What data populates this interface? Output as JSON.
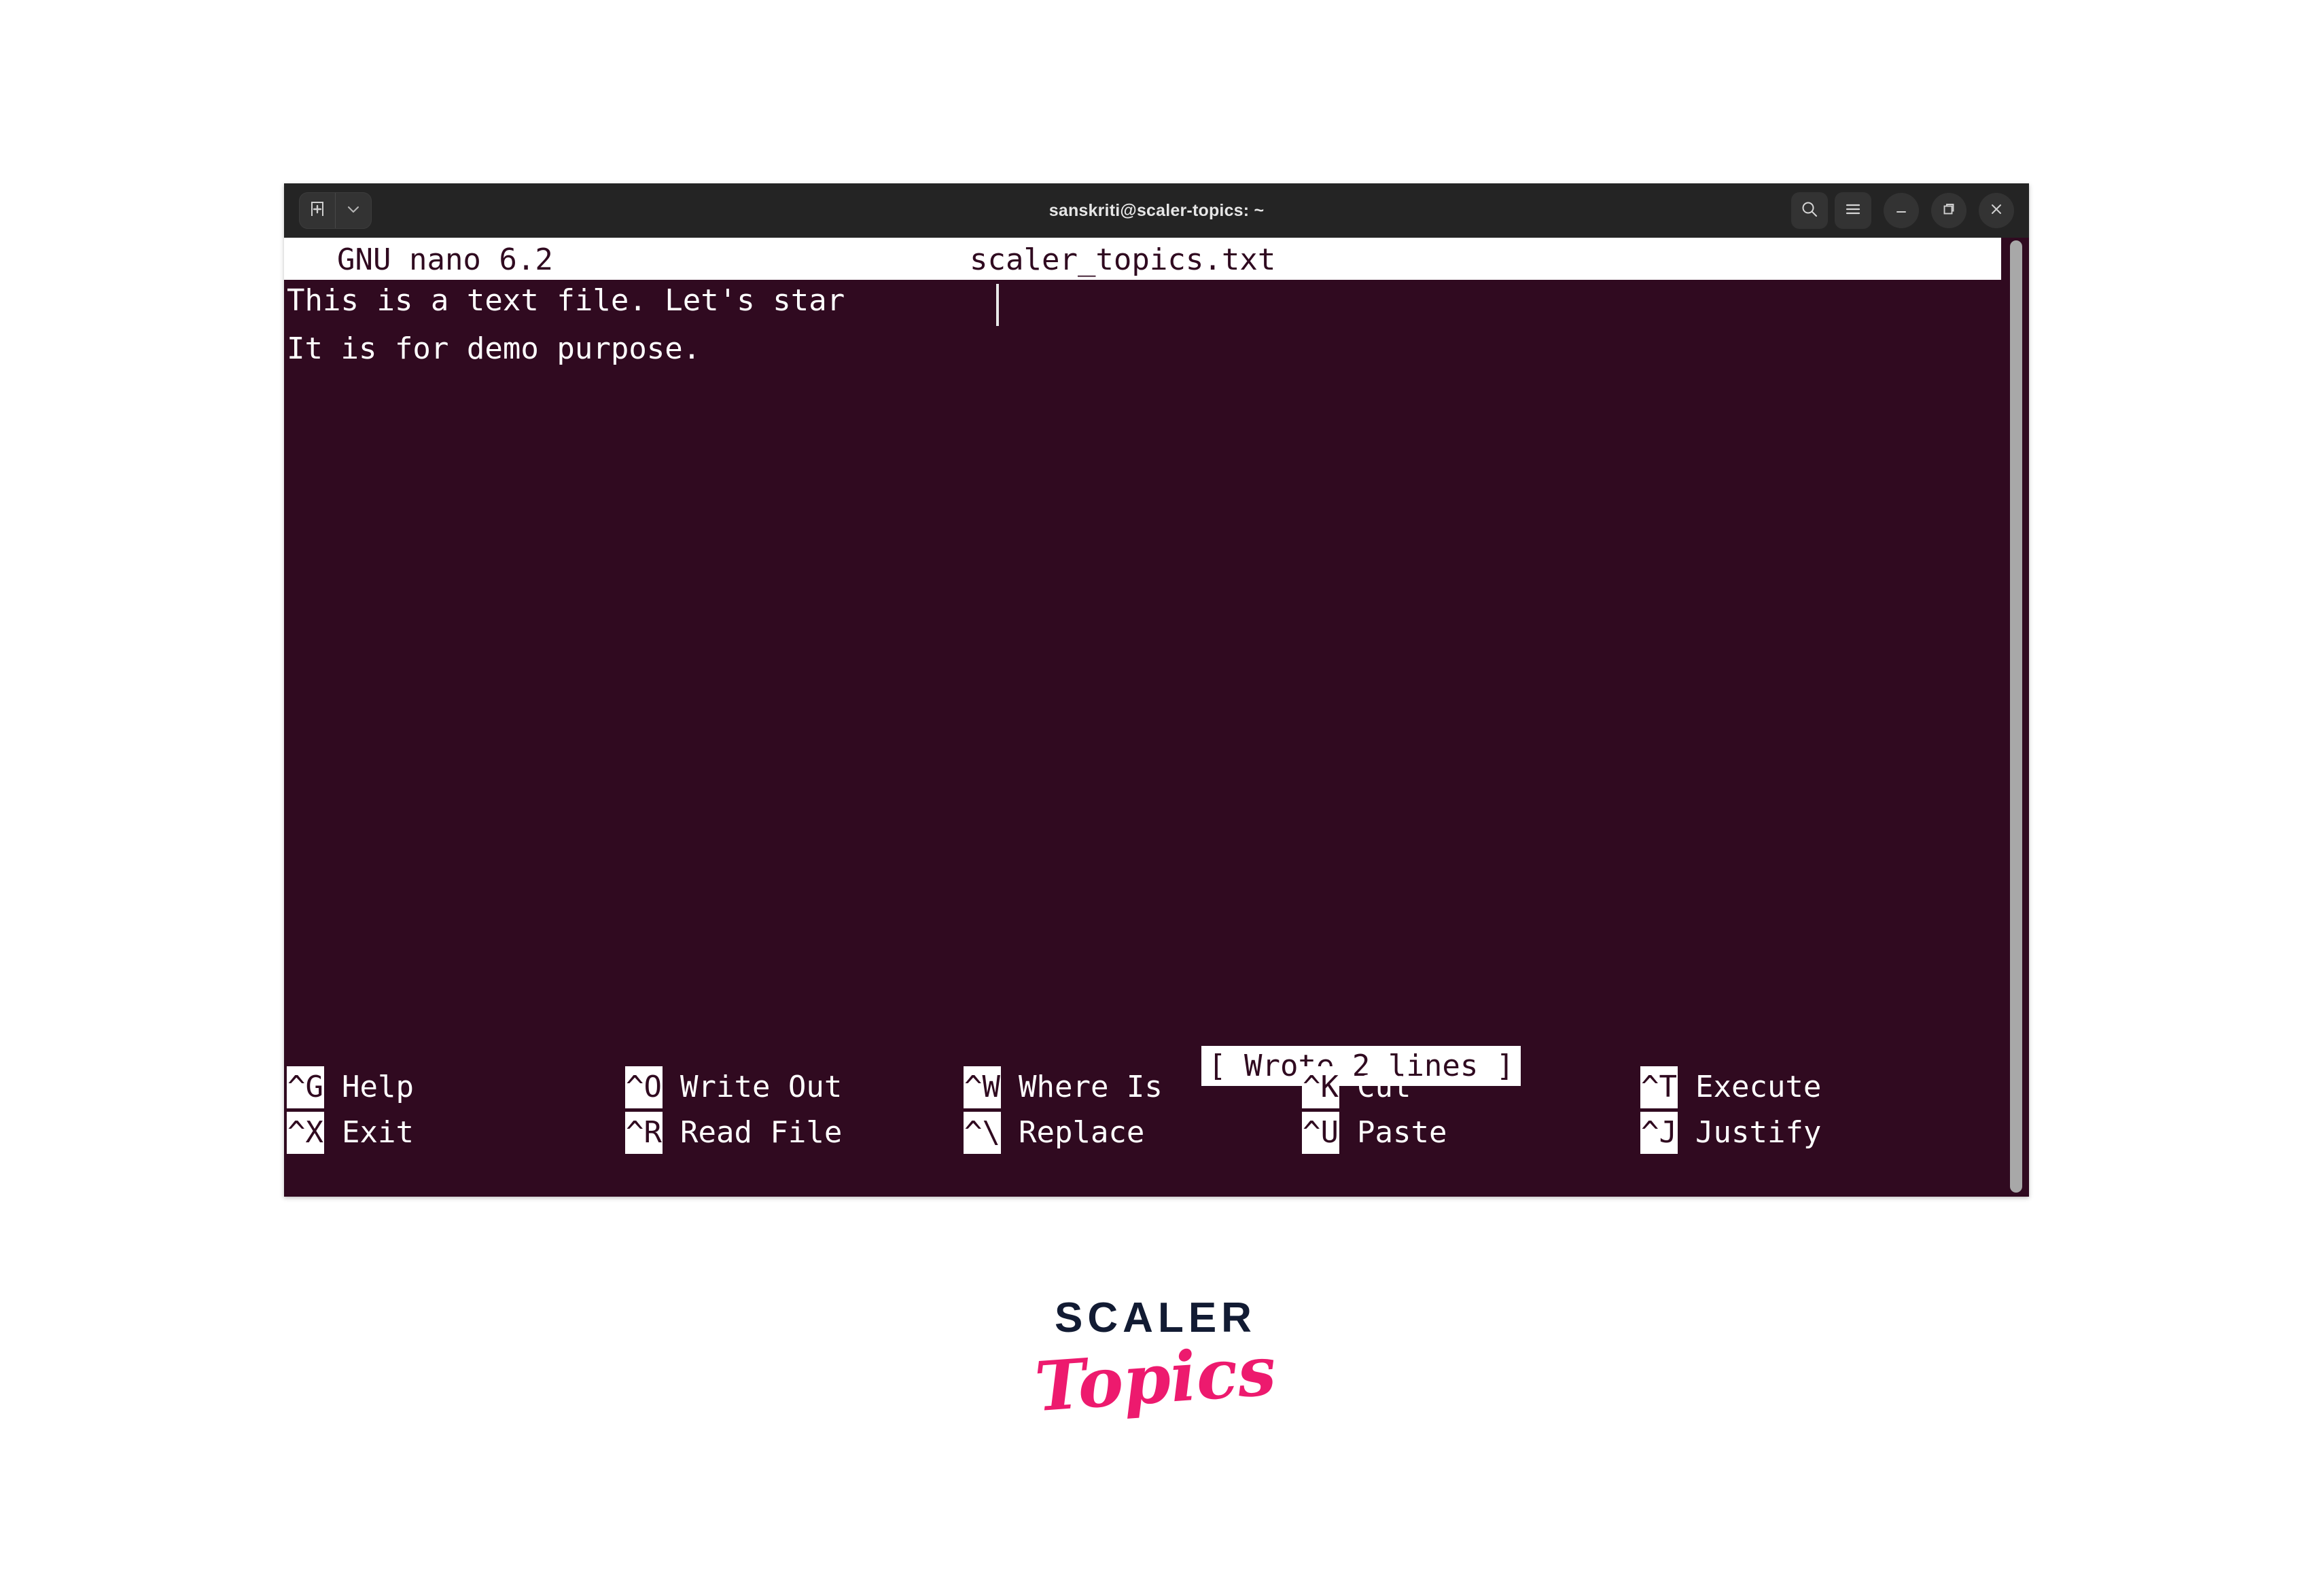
{
  "window": {
    "title": "sanskriti@scaler-topics: ~",
    "titlebar": {
      "new_tab_icon": "new-tab-icon",
      "tab_dropdown_icon": "chevron-down-icon",
      "search_icon": "search-icon",
      "menu_icon": "hamburger-menu-icon",
      "minimize_icon": "minimize-icon",
      "maximize_icon": "maximize-icon",
      "close_icon": "close-icon"
    }
  },
  "nano": {
    "version": "GNU nano 6.2",
    "filename": "scaler_topics.txt",
    "document_lines": [
      "This is a text file. Let's star",
      "It is for demo purpose."
    ],
    "status_message": "[ Wrote 2 lines ]",
    "shortcuts_row1": [
      {
        "key": "^G",
        "label": "Help"
      },
      {
        "key": "^O",
        "label": "Write Out"
      },
      {
        "key": "^W",
        "label": "Where Is"
      },
      {
        "key": "^K",
        "label": "Cut"
      },
      {
        "key": "^T",
        "label": "Execute"
      }
    ],
    "shortcuts_row2": [
      {
        "key": "^X",
        "label": "Exit"
      },
      {
        "key": "^R",
        "label": "Read File"
      },
      {
        "key": "^\\",
        "label": "Replace"
      },
      {
        "key": "^U",
        "label": "Paste"
      },
      {
        "key": "^J",
        "label": "Justify"
      }
    ]
  },
  "branding": {
    "name_top": "SCALER",
    "name_bottom": "Topics"
  },
  "colors": {
    "terminal_background": "#300a20",
    "titlebar_background": "#242424",
    "nano_bar_background": "#ffffff",
    "nano_bar_text": "#300a20",
    "terminal_text": "#ffffff",
    "scrollbar": "#a8a8a8",
    "brand_dark": "#121b33",
    "brand_pink": "#ed1a6e"
  }
}
